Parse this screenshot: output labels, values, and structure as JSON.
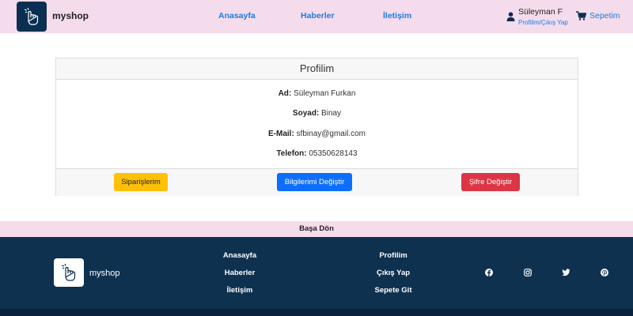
{
  "navbar": {
    "brand": "myshop",
    "links": [
      "Anasayfa",
      "Haberler",
      "İletişim"
    ],
    "user_name": "Süleyman F",
    "user_links": "Profilim/Çıkış Yap",
    "cart_label": "Sepetim"
  },
  "profile": {
    "title": "Profilim",
    "fields": [
      {
        "label": "Ad:",
        "value": "Süleyman Furkan"
      },
      {
        "label": "Soyad:",
        "value": "Binay"
      },
      {
        "label": "E-Mail:",
        "value": "sfbinay@gmail.com"
      },
      {
        "label": "Telefon:",
        "value": "05350628143"
      }
    ],
    "buttons": {
      "orders": "Siparişlerim",
      "edit_info": "Bilgilerimi Değiştir",
      "change_password": "Şifre Değiştir"
    }
  },
  "back_to_top": "Başa Dön",
  "footer": {
    "brand": "myshop",
    "col1": [
      "Anasayfa",
      "Haberler",
      "İletişim"
    ],
    "col2": [
      "Profilim",
      "Çıkış Yap",
      "Sepete Git"
    ],
    "social_icons": [
      "facebook-icon",
      "instagram-icon",
      "twitter-icon",
      "pinterest-icon"
    ]
  },
  "colors": {
    "nav_bg": "#f4dcec",
    "link": "#1f7ae0",
    "footer_bg": "#0e3150",
    "warning": "#ffc107",
    "primary": "#0d6efd",
    "danger": "#dc3545"
  }
}
